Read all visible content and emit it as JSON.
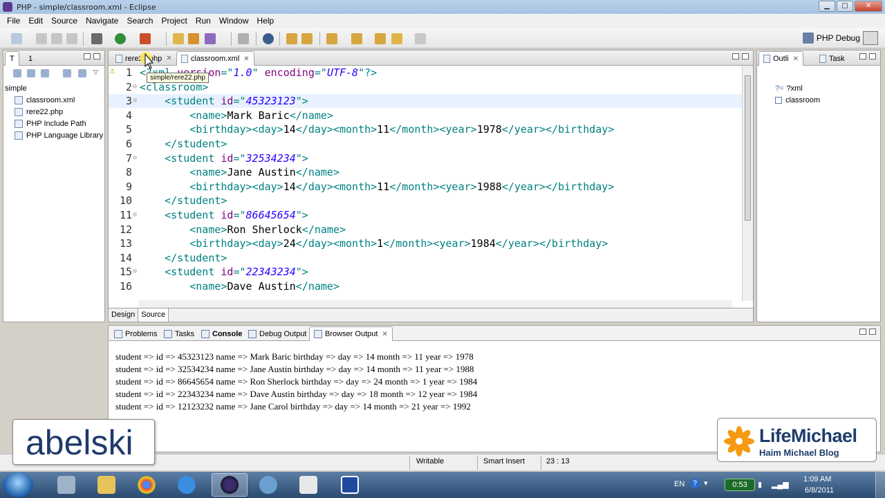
{
  "window": {
    "title": "PHP - simple/classroom.xml - Eclipse"
  },
  "menu": [
    "File",
    "Edit",
    "Source",
    "Navigate",
    "Search",
    "Project",
    "Run",
    "Window",
    "Help"
  ],
  "perspective": {
    "label": "PHP Debug"
  },
  "explorer": {
    "tabs": [
      "T",
      "1"
    ],
    "items": [
      {
        "label": "simple",
        "icon": "project-icon"
      },
      {
        "label": "classroom.xml",
        "icon": "xml-file-icon"
      },
      {
        "label": "rere22.php",
        "icon": "php-file-icon"
      },
      {
        "label": "PHP Include Path",
        "icon": "library-icon"
      },
      {
        "label": "PHP Language Library",
        "icon": "library-icon"
      }
    ]
  },
  "editor": {
    "tabs": [
      {
        "label": "rere22.php",
        "close": "✕"
      },
      {
        "label": "classroom.xml",
        "close": "✕"
      }
    ],
    "tooltip": "simple/rere22.php",
    "lines": [
      {
        "n": "1",
        "fold": "",
        "text": "<?xml version=\"1.0\" encoding=\"UTF-8\"?>"
      },
      {
        "n": "2",
        "fold": "⊖",
        "text": "<classroom>"
      },
      {
        "n": "3",
        "fold": "⊖",
        "text": "    <student id=\"45323123\">"
      },
      {
        "n": "4",
        "fold": "",
        "text": "        <name>Mark Baric</name>"
      },
      {
        "n": "5",
        "fold": "",
        "text": "        <birthday><day>14</day><month>11</month><year>1978</year></birthday>"
      },
      {
        "n": "6",
        "fold": "",
        "text": "    </student>"
      },
      {
        "n": "7",
        "fold": "⊖",
        "text": "    <student id=\"32534234\">"
      },
      {
        "n": "8",
        "fold": "",
        "text": "        <name>Jane Austin</name>"
      },
      {
        "n": "9",
        "fold": "",
        "text": "        <birthday><day>14</day><month>11</month><year>1988</year></birthday>"
      },
      {
        "n": "10",
        "fold": "",
        "text": "    </student>"
      },
      {
        "n": "11",
        "fold": "⊖",
        "text": "    <student id=\"86645654\">"
      },
      {
        "n": "12",
        "fold": "",
        "text": "        <name>Ron Sherlock</name>"
      },
      {
        "n": "13",
        "fold": "",
        "text": "        <birthday><day>24</day><month>1</month><year>1984</year></birthday>"
      },
      {
        "n": "14",
        "fold": "",
        "text": "    </student>"
      },
      {
        "n": "15",
        "fold": "⊖",
        "text": "    <student id=\"22343234\">"
      },
      {
        "n": "16",
        "fold": "",
        "text": "        <name>Dave Austin</name>"
      }
    ],
    "bottom_tabs": [
      "Design",
      "Source"
    ]
  },
  "outline": {
    "tabs": [
      {
        "label": "Outli",
        "close": "✕"
      },
      {
        "label": "Task",
        "close": ""
      }
    ],
    "items": [
      "?xml",
      "classroom"
    ]
  },
  "console": {
    "tabs": [
      {
        "label": "Problems",
        "close": ""
      },
      {
        "label": "Tasks",
        "close": ""
      },
      {
        "label": "Console",
        "close": ""
      },
      {
        "label": "Debug Output",
        "close": ""
      },
      {
        "label": "Browser Output",
        "close": "✕"
      }
    ],
    "lines": [
      "student => id => 45323123 name => Mark Baric birthday => day => 14 month => 11 year => 1978",
      "student => id => 32534234 name => Jane Austin birthday => day => 14 month => 11 year => 1988",
      "student => id => 86645654 name => Ron Sherlock birthday => day => 24 month => 1 year => 1984",
      "student => id => 22343234 name => Dave Austin birthday => day => 18 month => 12 year => 1984",
      "student => id => 12123232 name => Jane Carol birthday => day => 14 month => 21 year => 1992"
    ]
  },
  "status": {
    "mode": "Writable",
    "insert": "Smart Insert",
    "position": "23 : 13"
  },
  "overlays": {
    "abelski": "abelski",
    "lifemichael_title": "LifeMichael",
    "lifemichael_sub": "Haim Michael Blog"
  },
  "taskbar": {
    "lang": "EN",
    "battery_timer": "0:53",
    "time": "1:09 AM",
    "date": "6/8/2011"
  },
  "colors": {
    "xml_tag": "#008080",
    "xml_attr_value": "#2a00ff",
    "xml_attr_name": "#7f007f",
    "line_highlight": "#e8f2fe",
    "lifemichael_blue": "#1e3d6b",
    "lifemichael_orange": "#f59a12"
  }
}
